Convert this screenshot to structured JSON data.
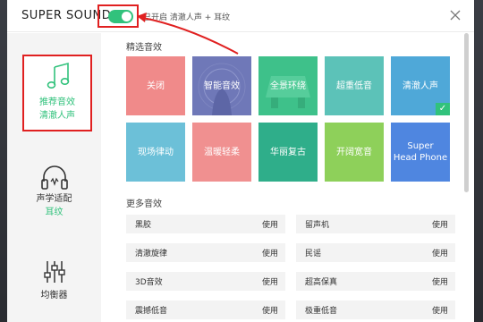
{
  "colors": {
    "accent": "#31c27c",
    "highlight_red": "#e02020"
  },
  "app": {
    "title": "SUPER SOUND"
  },
  "toggle": {
    "state": "on",
    "status_text": "已开启 清澈人声 + 耳纹"
  },
  "icons": {
    "close": "close-icon",
    "toggle": "toggle-switch"
  },
  "sidebar": {
    "items": [
      {
        "icon": "music-note-icon",
        "label": "推荐音效",
        "sub": "清澈人声"
      },
      {
        "icon": "headphones-icon",
        "label": "声学适配",
        "sub": "耳纹"
      },
      {
        "icon": "equalizer-icon",
        "label": "均衡器",
        "sub": ""
      }
    ]
  },
  "featured": {
    "title": "精选音效",
    "tiles": [
      {
        "label": "关闭",
        "color": "#f08a8a"
      },
      {
        "label": "智能音效",
        "color": "#6f78b8"
      },
      {
        "label": "全景环绕",
        "color": "#3ec18a"
      },
      {
        "label": "超重低音",
        "color": "#5cc2b8"
      },
      {
        "label": "清澈人声",
        "color": "#4fa8d8",
        "selected": true
      },
      {
        "label": "现场律动",
        "color": "#6cc0d8"
      },
      {
        "label": "温暖轻柔",
        "color": "#f09090"
      },
      {
        "label": "华丽复古",
        "color": "#2fae8a"
      },
      {
        "label": "开阔宽音",
        "color": "#8ed05a"
      },
      {
        "label": "Super Head Phone",
        "label_line1": "Super",
        "label_line2": "Head Phone",
        "color": "#4f86e0"
      }
    ]
  },
  "more": {
    "title": "更多音效",
    "use_label": "使用",
    "items": [
      {
        "name": "黑胶"
      },
      {
        "name": "留声机"
      },
      {
        "name": "清澈旋律"
      },
      {
        "name": "民谣"
      },
      {
        "name": "3D音效"
      },
      {
        "name": "超高保真"
      },
      {
        "name": "震撼低音"
      },
      {
        "name": "极重低音"
      }
    ]
  }
}
